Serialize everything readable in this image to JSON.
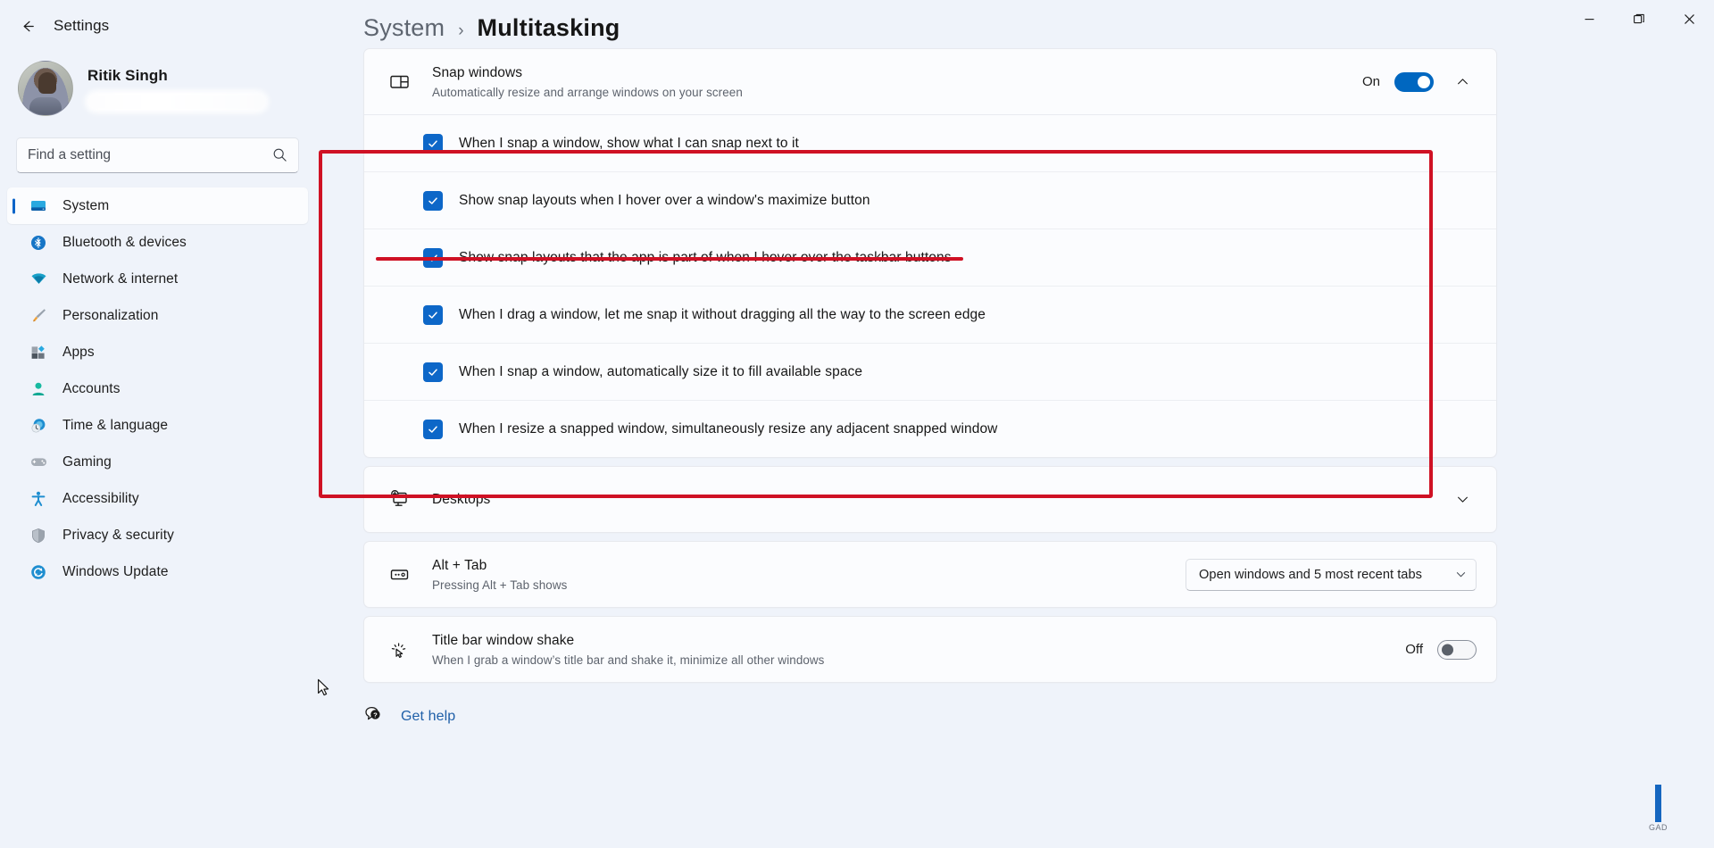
{
  "window": {
    "back_label": "Back",
    "app_title": "Settings",
    "controls": {
      "minimize": "Minimize",
      "maximize": "Restore",
      "close": "Close"
    }
  },
  "profile": {
    "name": "Ritik Singh",
    "email_hidden": ""
  },
  "search": {
    "placeholder": "Find a setting",
    "value": "",
    "icon": "search-icon"
  },
  "sidebar": {
    "items": [
      {
        "label": "System",
        "icon": "monitor-icon",
        "selected": true
      },
      {
        "label": "Bluetooth & devices",
        "icon": "bluetooth-icon",
        "selected": false
      },
      {
        "label": "Network & internet",
        "icon": "wifi-icon",
        "selected": false
      },
      {
        "label": "Personalization",
        "icon": "paintbrush-icon",
        "selected": false
      },
      {
        "label": "Apps",
        "icon": "apps-icon",
        "selected": false
      },
      {
        "label": "Accounts",
        "icon": "person-icon",
        "selected": false
      },
      {
        "label": "Time & language",
        "icon": "clock-icon",
        "selected": false
      },
      {
        "label": "Gaming",
        "icon": "gamepad-icon",
        "selected": false
      },
      {
        "label": "Accessibility",
        "icon": "accessibility-icon",
        "selected": false
      },
      {
        "label": "Privacy & security",
        "icon": "shield-icon",
        "selected": false
      },
      {
        "label": "Windows Update",
        "icon": "update-icon",
        "selected": false
      }
    ]
  },
  "breadcrumb": {
    "parent": "System",
    "separator": "›",
    "current": "Multitasking"
  },
  "snap_windows": {
    "title": "Snap windows",
    "subtitle": "Automatically resize and arrange windows on your screen",
    "icon": "snap-layout-icon",
    "toggle_state": "On",
    "expanded": true,
    "options": [
      {
        "label": "When I snap a window, show what I can snap next to it",
        "checked": true
      },
      {
        "label": "Show snap layouts when I hover over a window's maximize button",
        "checked": true
      },
      {
        "label": "Show snap layouts that the app is part of when I hover over the taskbar buttons",
        "checked": true
      },
      {
        "label": "When I drag a window, let me snap it without dragging all the way to the screen edge",
        "checked": true
      },
      {
        "label": "When I snap a window, automatically size it to fill available space",
        "checked": true
      },
      {
        "label": "When I resize a snapped window, simultaneously resize any adjacent snapped window",
        "checked": true
      }
    ]
  },
  "desktops": {
    "title": "Desktops",
    "icon": "desktop-add-icon",
    "expanded": false
  },
  "alt_tab": {
    "title": "Alt + Tab",
    "subtitle": "Pressing Alt + Tab shows",
    "icon": "alt-tab-icon",
    "dropdown_value": "Open windows and 5 most recent tabs"
  },
  "title_bar_shake": {
    "title": "Title bar window shake",
    "subtitle": "When I grab a window’s title bar and shake it, minimize all other windows",
    "icon": "shake-cursor-icon",
    "toggle_state": "Off"
  },
  "footer": {
    "get_help": "Get help",
    "icon": "help-icon"
  },
  "annotations": {
    "highlight_color": "#cf1124"
  },
  "watermark": {
    "text": "GAD"
  }
}
